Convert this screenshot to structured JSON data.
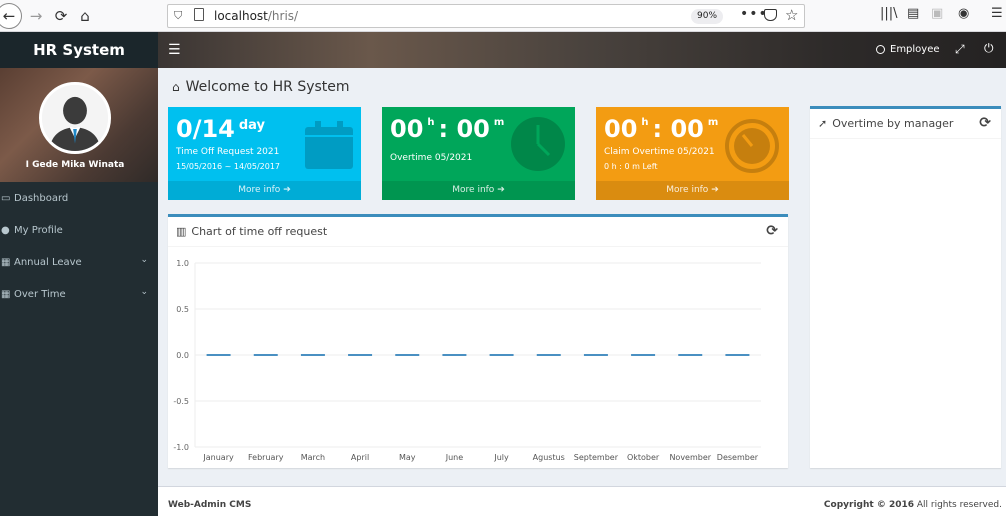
{
  "browser": {
    "url_host": "localhost",
    "url_path": "/hris/",
    "zoom": "90%"
  },
  "app": {
    "logo": "HR System",
    "user_name": "I Gede Mika Winata",
    "header_user": "Employee"
  },
  "sidebar": {
    "items": [
      {
        "label": "Dashboard",
        "icon": "monitor-icon",
        "has_submenu": false
      },
      {
        "label": "My Profile",
        "icon": "user-icon",
        "has_submenu": false
      },
      {
        "label": "Annual Leave",
        "icon": "calendar-icon",
        "has_submenu": true
      },
      {
        "label": "Over Time",
        "icon": "calendar-icon",
        "has_submenu": true
      }
    ]
  },
  "page": {
    "title": "Welcome to HR System"
  },
  "boxes": {
    "time_off": {
      "value": "0/14",
      "unit": "day",
      "label": "Time Off Request 2021",
      "sub": "15/05/2016 ~ 14/05/2017",
      "link": "More info",
      "color": "#00c0ef"
    },
    "overtime": {
      "hours": "00",
      "minutes": "00",
      "h_suffix": "h",
      "m_suffix": "m",
      "label": "Overtime 05/2021",
      "link": "More info",
      "color": "#00a65a"
    },
    "claim": {
      "hours": "00",
      "minutes": "00",
      "h_suffix": "h",
      "m_suffix": "m",
      "label": "Claim Overtime 05/2021",
      "sub": "0 h : 0 m Left",
      "link": "More info",
      "color": "#f39c12"
    }
  },
  "chart_panel": {
    "title": "Chart of time off request"
  },
  "manager_panel": {
    "title": "Overtime by manager"
  },
  "footer": {
    "left": "Web-Admin CMS",
    "right_bold": "Copyright © 2016",
    "right_rest": " All rights reserved."
  },
  "chart_data": {
    "type": "line",
    "categories": [
      "January",
      "February",
      "March",
      "April",
      "May",
      "June",
      "July",
      "Agustus",
      "September",
      "Oktober",
      "November",
      "Desember"
    ],
    "series": [
      {
        "values": [
          0,
          0,
          0,
          0,
          0,
          0,
          0,
          0,
          0,
          0,
          0,
          0
        ],
        "color": "#4a90c2"
      }
    ],
    "yticks": [
      "1.0",
      "0.5",
      "0.0",
      "-0.5",
      "-1.0"
    ],
    "ylim": [
      -1.0,
      1.0
    ],
    "grid": true
  }
}
